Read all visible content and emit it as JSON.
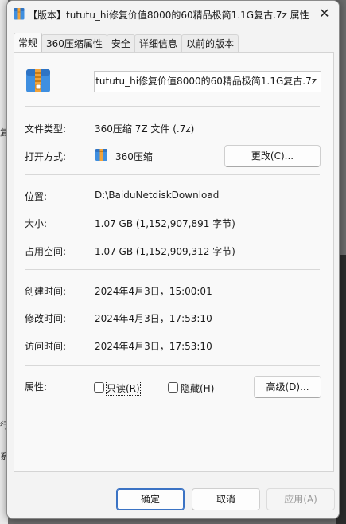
{
  "window": {
    "title": "【版本】tututu_hi修复价值8000的60精品极简1.1G复古.7z 属性",
    "close_glyph": "✕"
  },
  "background": {
    "left_fragments": [
      "复",
      "行",
      "系"
    ]
  },
  "tabs": [
    {
      "label": "常规",
      "active": true
    },
    {
      "label": "360压缩属性",
      "active": false
    },
    {
      "label": "安全",
      "active": false
    },
    {
      "label": "详细信息",
      "active": false
    },
    {
      "label": "以前的版本",
      "active": false
    }
  ],
  "general": {
    "file_name": "【版本】tututu_hi修复价值8000的60精品极简1.1G复古.7z",
    "file_type_label": "文件类型:",
    "file_type_value": "360压缩 7Z 文件 (.7z)",
    "open_with_label": "打开方式:",
    "open_with_value": "360压缩",
    "change_button": "更改(C)...",
    "location_label": "位置:",
    "location_value": "D:\\BaiduNetdiskDownload",
    "size_label": "大小:",
    "size_value": "1.07 GB (1,152,907,891 字节)",
    "size_on_disk_label": "占用空间:",
    "size_on_disk_value": "1.07 GB (1,152,909,312 字节)",
    "created_label": "创建时间:",
    "created_value": "2024年4月3日，15:00:01",
    "modified_label": "修改时间:",
    "modified_value": "2024年4月3日，17:53:10",
    "accessed_label": "访问时间:",
    "accessed_value": "2024年4月3日，17:53:10",
    "attributes_label": "属性:",
    "readonly_label": "只读(R)",
    "hidden_label": "隐藏(H)",
    "advanced_button": "高级(D)..."
  },
  "footer": {
    "ok": "确定",
    "cancel": "取消",
    "apply": "应用(A)"
  },
  "colors": {
    "accent": "#3b73c4",
    "archive_icon_blue": "#3f8fe0",
    "archive_icon_orange": "#f2a33a"
  }
}
